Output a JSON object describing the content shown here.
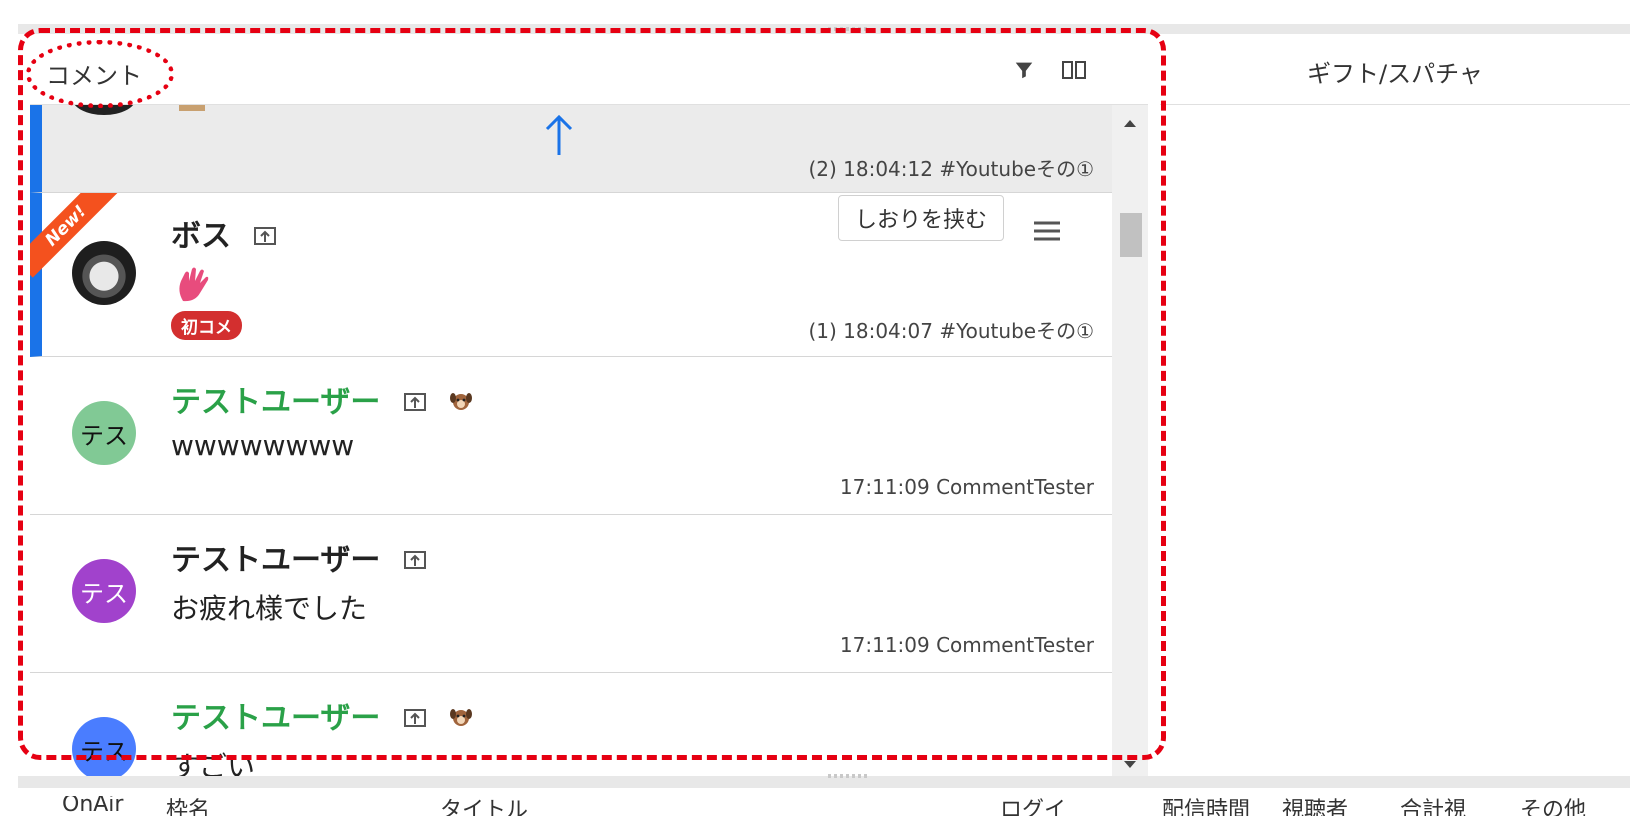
{
  "comment_panel": {
    "title": "コメント",
    "bookmark_row": {
      "meta": "(2) 18:04:12 #Youtubeその①"
    },
    "rows": [
      {
        "name": "ボス",
        "message": "",
        "badge": "初コメ",
        "meta": "(1) 18:04:07 #Youtubeその①",
        "new_label": "New!",
        "bookmark_button": "しおりを挟む"
      },
      {
        "name": "テストユーザー",
        "avatar": "テス",
        "avatar_color": "#81c995",
        "message": "wwwwwwww",
        "meta": "17:11:09 CommentTester"
      },
      {
        "name": "テストユーザー",
        "avatar": "テス",
        "avatar_color": "#a142cc",
        "message": "お疲れ様でした",
        "meta": "17:11:09 CommentTester"
      },
      {
        "name": "テストユーザー",
        "avatar": "テス",
        "avatar_color": "#4a7dff",
        "message": "すごい",
        "meta": ""
      }
    ]
  },
  "gift_panel": {
    "title": "ギフト/スパチャ"
  },
  "bottom_columns": [
    "OnAir",
    "枠名",
    "タイトル",
    "ログイ",
    "配信時間",
    "視聴者",
    "合計視",
    "その他"
  ],
  "colors": {
    "accent_blue": "#1a73e8",
    "green_name": "#2aa148",
    "badge_red": "#d32f2f",
    "annotation_red": "#e60012"
  }
}
